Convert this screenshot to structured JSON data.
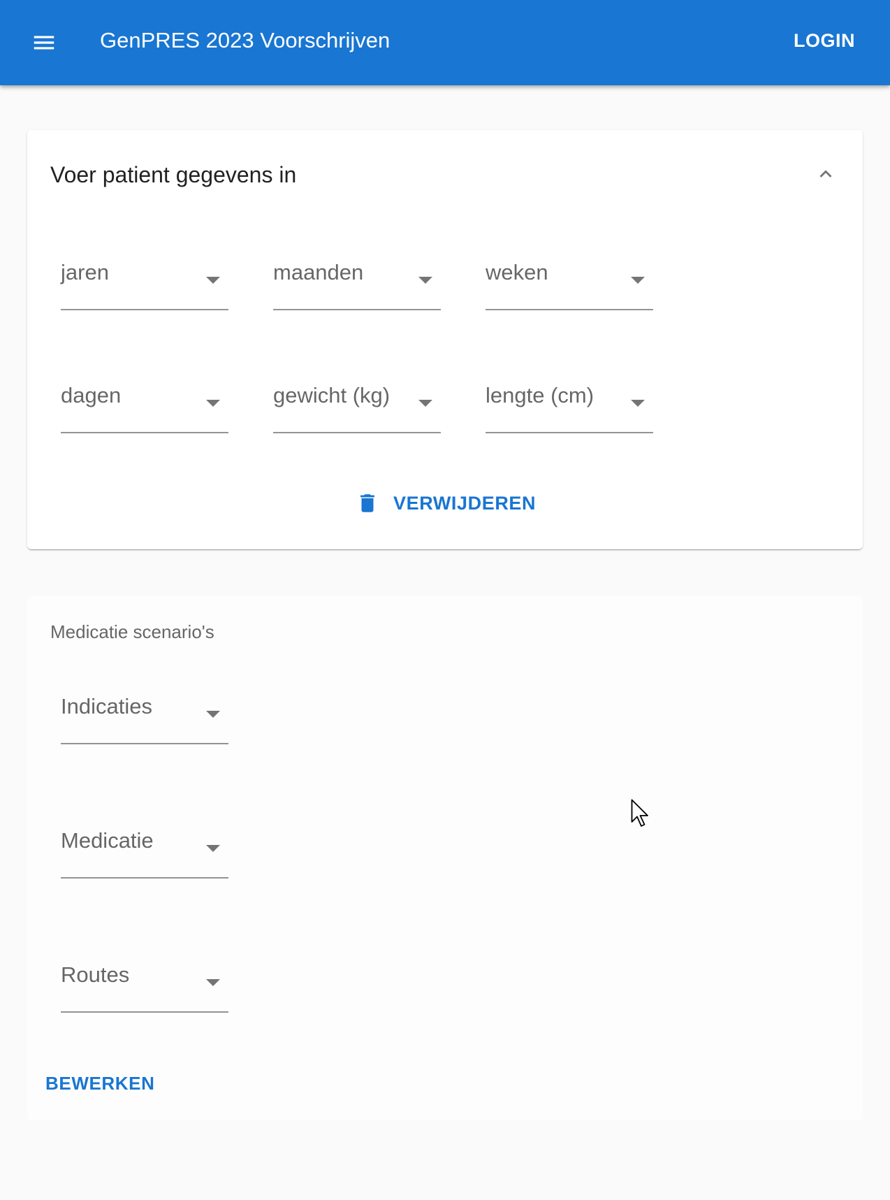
{
  "appbar": {
    "title": "GenPRES 2023 Voorschrijven",
    "login_label": "LOGIN",
    "menu_icon": "menu-icon",
    "color": "#1976d2"
  },
  "patient_card": {
    "title": "Voer patient gegevens in",
    "collapse_icon": "chevron-up-icon",
    "fields": {
      "jaren": "jaren",
      "maanden": "maanden",
      "weken": "weken",
      "dagen": "dagen",
      "gewicht": "gewicht (kg)",
      "lengte": "lengte (cm)"
    },
    "delete_label": "VERWIJDEREN",
    "delete_icon": "trash-icon"
  },
  "scenario_card": {
    "label": "Medicatie scenario's",
    "fields": {
      "indicaties": "Indicaties",
      "medicatie": "Medicatie",
      "routes": "Routes"
    },
    "edit_label": "BEWERKEN"
  }
}
